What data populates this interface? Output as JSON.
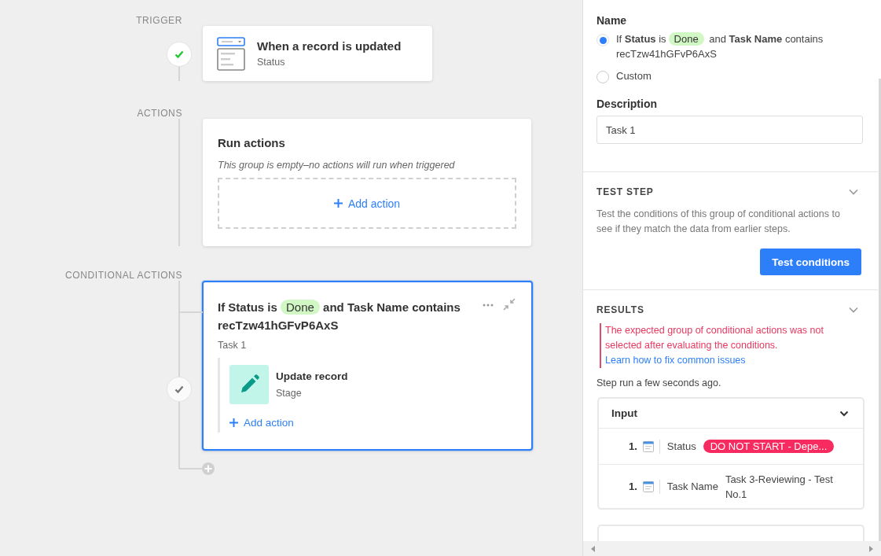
{
  "canvas": {
    "sections": [
      {
        "kind": "trigger",
        "label": "TRIGGER",
        "passed": true,
        "title": "When a record is updated",
        "subtitle": "Status"
      },
      {
        "kind": "group",
        "label": "ACTIONS",
        "title": "Run actions",
        "note": "This group is empty–no actions will run when triggered",
        "add_action": "Add action"
      },
      {
        "kind": "conditional",
        "label": "CONDITIONAL ACTIONS",
        "passed": false,
        "selected": true,
        "condition": {
          "before": "If Status is",
          "value": "Done",
          "after": "and Task Name contains recTzw41hGFvP6AxS"
        },
        "description": "Task 1",
        "actions": [
          {
            "title": "Update record",
            "subtitle": "Stage"
          }
        ],
        "add_action": "Add action"
      }
    ]
  },
  "panel": {
    "labels": {
      "name_label": "Name",
      "options": [
        {
          "before": "If **Status** is",
          "value": "Done",
          "after": "and **Task Name** contains recTzw41hGFvP6AxS",
          "selected": true
        },
        {
          "before": "Custom",
          "selected": false
        }
      ],
      "description_label": "Description",
      "description_value": "Task 1"
    },
    "test_step": {
      "title": "TEST STEP",
      "text": "Test the conditions of this group of conditional actions to see if they match the data from earlier steps.",
      "button": "Test conditions"
    },
    "results": {
      "title": "RESULTS",
      "error": "The expected group of conditional actions was not selected after evaluating the conditions.",
      "link": "Learn how to fix common issues",
      "run_note": "Step run a few seconds ago.",
      "input": {
        "title": "Input",
        "rows": [
          {
            "index": "1.",
            "field": "Status",
            "kind": "pill",
            "value": "DO NOT START - Depe..."
          },
          {
            "index": "1.",
            "field": "Task Name",
            "kind": "text",
            "value": "Task 3-Reviewing - Test No.1"
          }
        ]
      }
    }
  }
}
